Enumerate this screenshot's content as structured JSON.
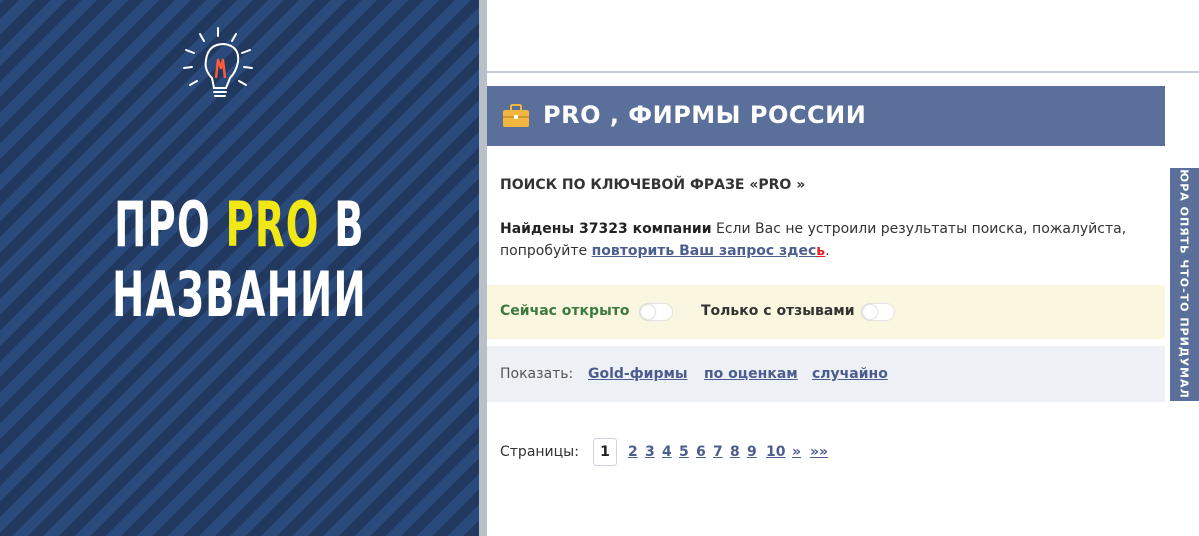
{
  "banner": {
    "line1_before": "ПРО ",
    "line1_accent": "PRO",
    "line1_after": " В",
    "line2": "НАЗВАНИИ",
    "accent_color": "#f1e714",
    "icon": "lightbulb-icon"
  },
  "header": {
    "title": "PRO , ФИРМЫ РОССИИ",
    "icon": "briefcase-icon",
    "bg_color": "#5a6f99"
  },
  "search": {
    "title": "ПОИСК ПО КЛЮЧЕВОЙ ФРАЗЕ «PRO »",
    "found_count": "Найдены 37323 компании",
    "found_rest": " Если Вас не устроили результаты поиска, пожалуйста, попробуйте ",
    "retry_link_main": "повторить Ваш запрос здес",
    "retry_link_last": "ь",
    "after_link": "."
  },
  "filters": {
    "open_now": "Сейчас открыто",
    "with_reviews": "Только с отзывами",
    "open_now_on": false,
    "with_reviews_on": false
  },
  "show": {
    "label": "Показать:",
    "links": [
      "Gold-фирмы",
      "по оценкам",
      "случайно"
    ]
  },
  "pagination": {
    "label": "Страницы:",
    "current": "1",
    "pages": [
      "2",
      "3",
      "4",
      "5",
      "6",
      "7",
      "8",
      "9",
      "10",
      "»",
      "»»"
    ]
  },
  "side_tab": {
    "text": "ЮРА ОПЯТЬ ЧТО-ТО ПРИДУМАЛ"
  }
}
